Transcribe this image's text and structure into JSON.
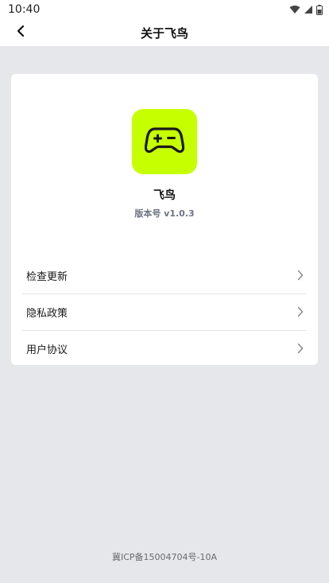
{
  "status_bar": {
    "time": "10:40",
    "icons": [
      "wifi-icon",
      "cell-signal-icon",
      "battery-icon"
    ]
  },
  "header": {
    "title": "关于飞鸟",
    "back_icon": "chevron-left-icon"
  },
  "app": {
    "logo_icon": "gamepad-icon",
    "logo_color": "#c6ff00",
    "name": "飞鸟",
    "version": "版本号 v1.0.3"
  },
  "menu": {
    "items": [
      {
        "label": "检查更新",
        "icon": "chevron-right-icon"
      },
      {
        "label": "隐私政策",
        "icon": "chevron-right-icon"
      },
      {
        "label": "用户协议",
        "icon": "chevron-right-icon"
      }
    ]
  },
  "footer": {
    "icp": "冀ICP备15004704号-10A"
  },
  "colors": {
    "background": "#e6e7eb",
    "card": "#ffffff",
    "accent": "#c6ff00"
  }
}
